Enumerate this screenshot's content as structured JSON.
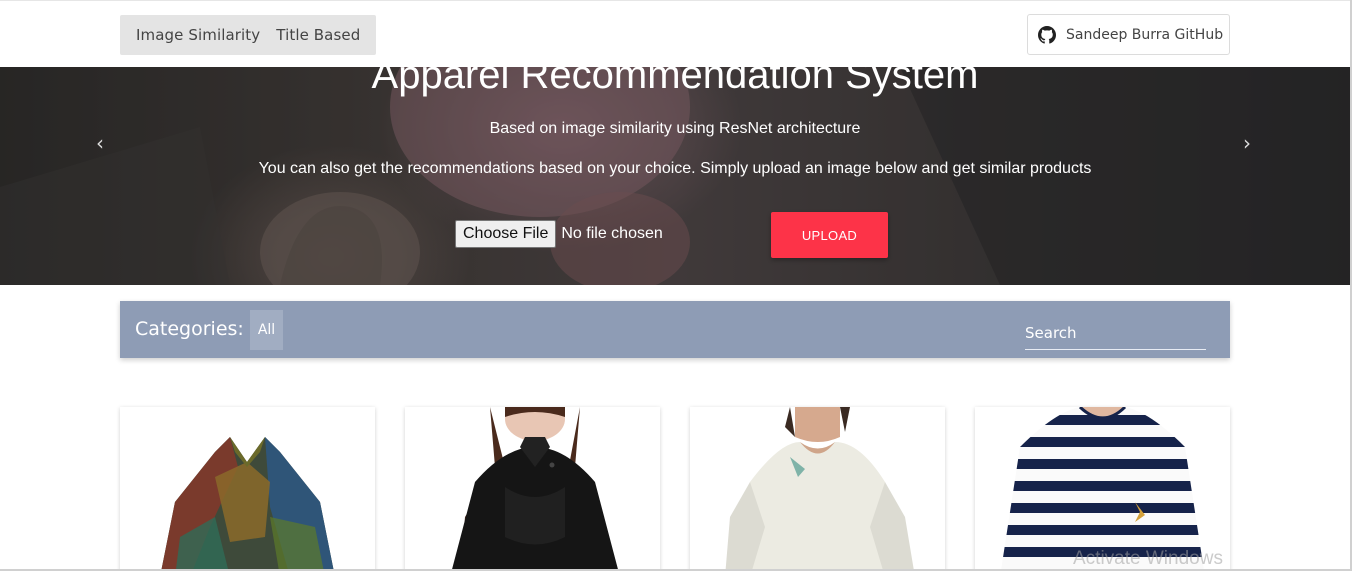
{
  "nav": {
    "links": [
      {
        "label": "Image Similarity"
      },
      {
        "label": "Title Based"
      }
    ],
    "github_label": "Sandeep Burra GitHub",
    "github_icon": "github-icon"
  },
  "hero": {
    "title": "Apparel Recommendation System",
    "subtitle": "Based on image similarity using ResNet architecture",
    "description": "You can also get the recommendations based on your choice. Simply upload an image below and get similar products",
    "prev_arrow": "‹",
    "next_arrow": "›",
    "file_button": "Choose File",
    "file_status": "No file chosen",
    "upload_label": "UPLOAD",
    "upload_color": "#fd3348"
  },
  "categories": {
    "label": "Categories:",
    "selected": "All",
    "search_placeholder": "Search",
    "bar_color": "#8e9cb5"
  },
  "products": [
    {
      "name": "patchwork-jacket"
    },
    {
      "name": "black-ruffle-blouse"
    },
    {
      "name": "white-linen-top"
    },
    {
      "name": "striped-sweater"
    }
  ],
  "watermark": "Activate Windows"
}
